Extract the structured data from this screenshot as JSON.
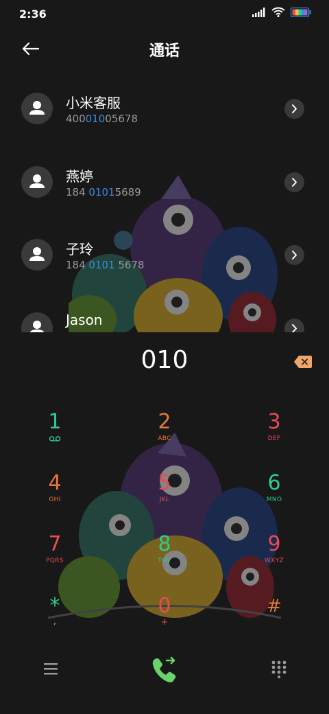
{
  "status": {
    "time": "2:36"
  },
  "header": {
    "title": "通话"
  },
  "contacts": [
    {
      "name": "小米客服",
      "number_pre": "400",
      "number_hl": "010",
      "number_post": "05678"
    },
    {
      "name": "燕婷",
      "number_pre": "184 ",
      "number_hl": "0101",
      "number_post": "5689"
    },
    {
      "name": "子玲",
      "number_pre": "184 ",
      "number_hl": "0101",
      "number_post": " 5678"
    },
    {
      "name": "Jason",
      "number_pre": "",
      "number_hl": "",
      "number_post": ""
    }
  ],
  "dialer": {
    "digits": "010",
    "keys": [
      {
        "num": "1",
        "sub": "",
        "color": "#2ecc8f"
      },
      {
        "num": "2",
        "sub": "ABC",
        "color": "#e8783a"
      },
      {
        "num": "3",
        "sub": "DEF",
        "color": "#e84a5a"
      },
      {
        "num": "4",
        "sub": "GHI",
        "color": "#e8783a"
      },
      {
        "num": "5",
        "sub": "JKL",
        "color": "#e84a5a"
      },
      {
        "num": "6",
        "sub": "MNO",
        "color": "#2ecc8f"
      },
      {
        "num": "7",
        "sub": "PQRS",
        "color": "#e84a5a"
      },
      {
        "num": "8",
        "sub": "TUV",
        "color": "#2ecc8f"
      },
      {
        "num": "9",
        "sub": "WXYZ",
        "color": "#e84a5a"
      },
      {
        "num": "*",
        "sub": ",",
        "color": "#2ecc8f"
      },
      {
        "num": "0",
        "sub": "+",
        "color": "#e84a5a"
      },
      {
        "num": "#",
        "sub": "",
        "color": "#e8783a"
      }
    ]
  },
  "colors": {
    "accent_blue": "#3b8de0",
    "call_green": "#6ad36a",
    "backspace_orange": "#f0a56a"
  },
  "icons": {
    "back": "arrow-left-icon",
    "avatar": "person-icon",
    "detail": "chevron-right-icon",
    "backspace": "backspace-icon",
    "voicemail": "voicemail-icon",
    "menu": "menu-icon",
    "call": "phone-icon",
    "keypad": "keypad-icon"
  }
}
